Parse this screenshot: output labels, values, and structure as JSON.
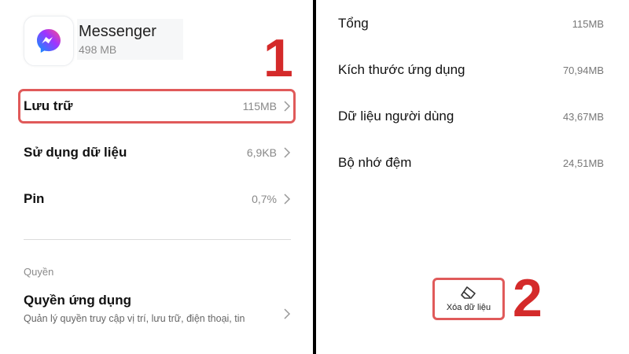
{
  "left": {
    "app": {
      "name": "Messenger",
      "size": "498 MB",
      "icon": "messenger-icon"
    },
    "step_number": "1",
    "rows": [
      {
        "label": "Lưu trữ",
        "value": "115MB"
      },
      {
        "label": "Sử dụng dữ liệu",
        "value": "6,9KB"
      },
      {
        "label": "Pin",
        "value": "0,7%"
      }
    ],
    "permissions": {
      "section_title": "Quyền",
      "label": "Quyền ứng dụng",
      "description": "Quản lý quyền truy cập vị trí, lưu trữ, điện thoại, tin"
    }
  },
  "right": {
    "stats": [
      {
        "label": "Tổng",
        "value": "115MB"
      },
      {
        "label": "Kích thước ứng dụng",
        "value": "70,94MB"
      },
      {
        "label": "Dữ liệu người dùng",
        "value": "43,67MB"
      },
      {
        "label": "Bộ nhớ đệm",
        "value": "24,51MB"
      }
    ],
    "clear_button": {
      "label": "Xóa dữ liệu",
      "icon": "eraser-icon"
    },
    "step_number": "2"
  },
  "colors": {
    "highlight": "#e05a5a",
    "step_number": "#d42a2a",
    "messenger_gradient": [
      "#0099ff",
      "#a033ff",
      "#ff5280"
    ]
  }
}
